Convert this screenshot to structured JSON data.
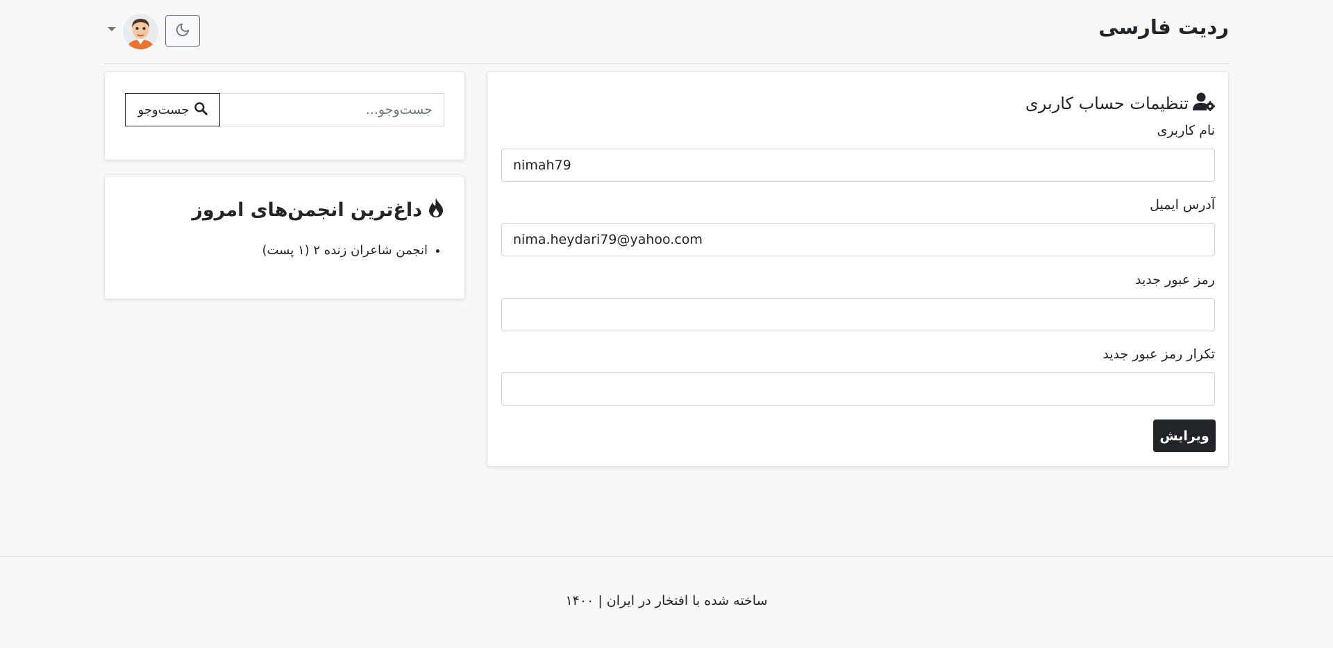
{
  "header": {
    "brand": "ردیت فارسی",
    "theme_icon": "moon-icon",
    "avatar_icon": "avatar-icon",
    "dropdown_icon": "caret-down-icon"
  },
  "settings": {
    "title": "تنظیمات حساب کاربری",
    "title_icon": "user-gear-icon",
    "username_label": "نام کاربری",
    "username_value": "nimah79",
    "email_label": "آدرس ایمیل",
    "email_value": "nima.heydari79@yahoo.com",
    "new_password_label": "رمز عبور جدید",
    "new_password_value": "",
    "repeat_password_label": "تکرار رمز عبور جدید",
    "repeat_password_value": "",
    "submit_label": "ویرایش"
  },
  "search": {
    "placeholder": "جست‌وجو...",
    "button_label": "جست‌وجو",
    "button_icon": "search-icon"
  },
  "hot_communities": {
    "title": "داغ‌ترین انجمن‌های امروز",
    "title_icon": "fire-icon",
    "items": [
      {
        "label": "انجمن شاعران زنده ۲ (۱ پست)"
      }
    ]
  },
  "footer": {
    "text": "ساخته شده با افتخار در ایران | ۱۴۰۰"
  },
  "colors": {
    "background": "#f8f8f8",
    "primary_dark": "#212529"
  }
}
